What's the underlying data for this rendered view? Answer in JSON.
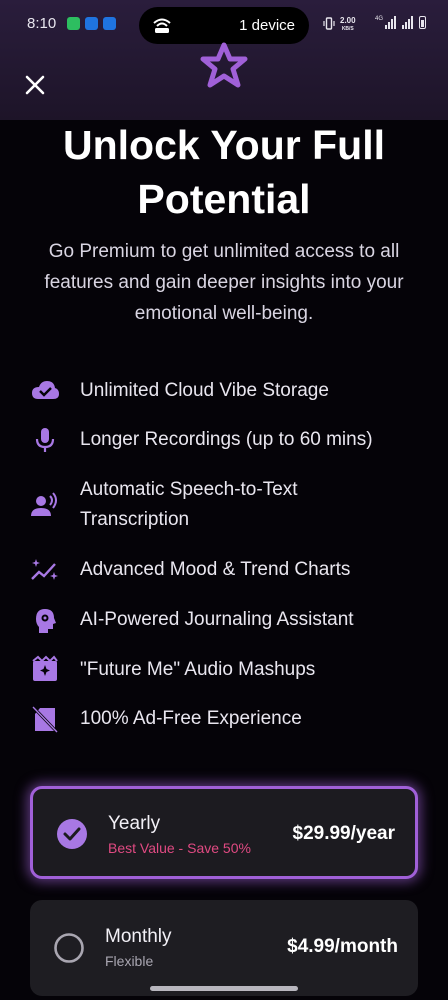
{
  "status_bar": {
    "time": "8:10",
    "device_count": "1 device",
    "net_speed": "2.00",
    "net_unit": "KB/S",
    "network_type": "4G",
    "icons": [
      "evernote-icon",
      "cloud-icon",
      "cloud-icon",
      "hotspot-icon",
      "vibrate-icon",
      "signal-icon",
      "signal-icon",
      "battery-icon"
    ]
  },
  "header": {
    "close_icon": "close-icon",
    "badge_icon": "star-icon"
  },
  "title": "Unlock Your Full Potential",
  "subtitle": "Go Premium to get unlimited access to all features and gain deeper insights into your emotional well-being.",
  "features": [
    {
      "icon": "cloud-check-icon",
      "label": "Unlimited Cloud Vibe Storage"
    },
    {
      "icon": "microphone-icon",
      "label": "Longer Recordings (up to 60 mins)"
    },
    {
      "icon": "voice-person-icon",
      "label": "Automatic Speech-to-Text Transcription"
    },
    {
      "icon": "trend-sparkle-icon",
      "label": "Advanced Mood & Trend Charts"
    },
    {
      "icon": "ai-head-icon",
      "label": "AI-Powered Journaling Assistant"
    },
    {
      "icon": "movie-sparkle-icon",
      "label": "\"Future Me\" Audio Mashups"
    },
    {
      "icon": "no-ads-icon",
      "label": "100% Ad-Free Experience"
    }
  ],
  "plans": [
    {
      "name": "Yearly",
      "subtext": "Best Value - Save 50%",
      "price": "$29.99/year",
      "selected": true
    },
    {
      "name": "Monthly",
      "subtext": "Flexible",
      "price": "$4.99/month",
      "selected": false
    }
  ],
  "colors": {
    "accent": "#a060d8",
    "icon_purple": "#a878e4",
    "highlight_pink": "#e04a82",
    "background": "#050308",
    "card": "#1c1b20"
  }
}
